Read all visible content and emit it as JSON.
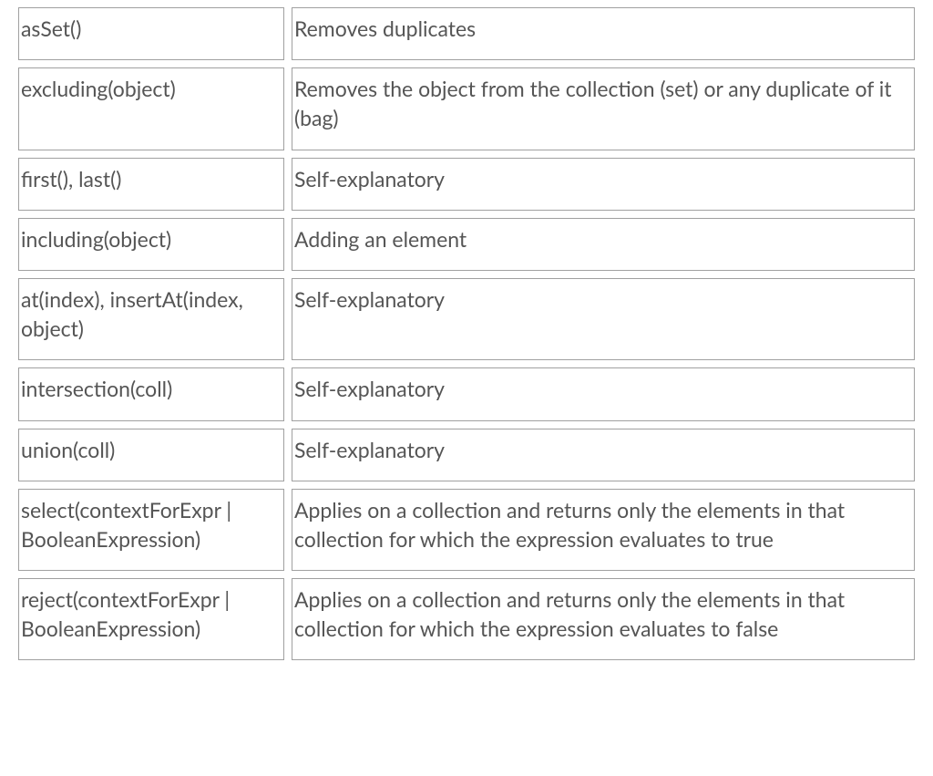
{
  "rows": [
    {
      "operation": "asSet()",
      "description": "Removes duplicates"
    },
    {
      "operation": "excluding(object)",
      "description": "Removes the object from the collection (set) or any duplicate of it (bag)"
    },
    {
      "operation": "first(), last()",
      "description": "Self-explanatory"
    },
    {
      "operation": "including(object)",
      "description": "Adding an element"
    },
    {
      "operation": "at(index), insertAt(index, object)",
      "description": "Self-explanatory"
    },
    {
      "operation": "intersection(coll)",
      "description": "Self-explanatory"
    },
    {
      "operation": "union(coll)",
      "description": "Self-explanatory"
    },
    {
      "operation": "select(contextForExpr | BooleanExpression)",
      "description": "Applies on a collection and returns only the elements in that collection for which the expression evaluates to true"
    },
    {
      "operation": "reject(contextForExpr | BooleanExpression)",
      "description": "Applies on a collection and returns only the elements in that collection for which the expression evaluates to false"
    }
  ]
}
